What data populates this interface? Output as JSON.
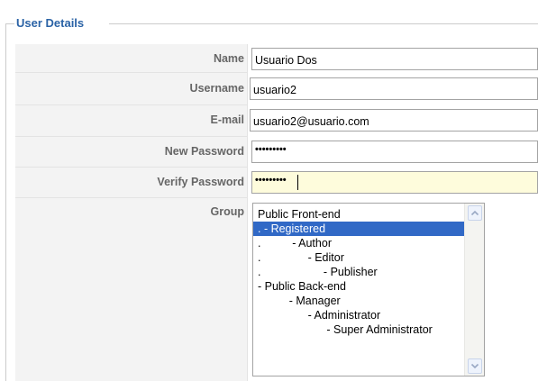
{
  "fieldset": {
    "legend": "User Details"
  },
  "fields": {
    "name": {
      "label": "Name",
      "value": "Usuario Dos"
    },
    "username": {
      "label": "Username",
      "value": "usuario2"
    },
    "email": {
      "label": "E-mail",
      "value": "usuario2@usuario.com"
    },
    "new_password": {
      "label": "New Password",
      "value": "•••••••••"
    },
    "verify_password": {
      "label": "Verify Password",
      "value": "•••••••••"
    },
    "group": {
      "label": "Group",
      "options": [
        "Public Front-end",
        ". - Registered",
        ".          - Author",
        ".               - Editor",
        ".                    - Publisher",
        "- Public Back-end",
        "          - Manager",
        "                - Administrator",
        "                      - Super Administrator"
      ],
      "selected_index": 1
    }
  },
  "colors": {
    "legend": "#2b63a6",
    "label": "#666666",
    "label_bg": "#f3f3f3",
    "focused_input_bg": "#fefcdc",
    "selection_bg": "#3169c6"
  },
  "icons": {
    "scroll_up": "chevron-up-icon",
    "scroll_down": "chevron-down-icon"
  }
}
